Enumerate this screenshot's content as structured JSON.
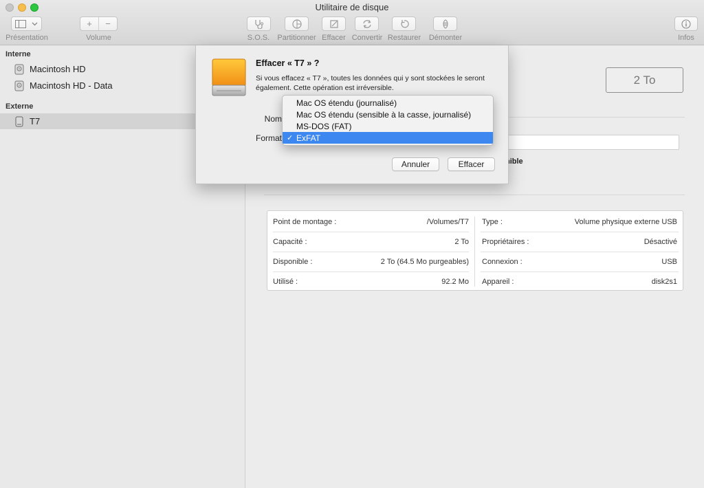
{
  "window": {
    "title": "Utilitaire de disque"
  },
  "toolbar": {
    "presentation_label": "Présentation",
    "volume_label": "Volume",
    "volume_add": "+",
    "volume_remove": "−",
    "sos_label": "S.O.S.",
    "partition_label": "Partitionner",
    "erase_label": "Effacer",
    "convert_label": "Convertir",
    "restore_label": "Restaurer",
    "unmount_label": "Démonter",
    "info_label": "Infos"
  },
  "sidebar": {
    "internal_header": "Interne",
    "external_header": "Externe",
    "internal_items": [
      {
        "label": "Macintosh HD"
      },
      {
        "label": "Macintosh HD - Data"
      }
    ],
    "external_items": [
      {
        "label": "T7"
      }
    ]
  },
  "main": {
    "capacity_box": "2 To",
    "behind_text": "nible",
    "info": {
      "left": [
        {
          "key": "Point de montage :",
          "value": "/Volumes/T7"
        },
        {
          "key": "Capacité :",
          "value": "2 To"
        },
        {
          "key": "Disponible :",
          "value": "2 To (64.5 Mo purgeables)"
        },
        {
          "key": "Utilisé :",
          "value": "92.2 Mo"
        }
      ],
      "right": [
        {
          "key": "Type :",
          "value": "Volume physique externe USB"
        },
        {
          "key": "Propriétaires :",
          "value": "Désactivé"
        },
        {
          "key": "Connexion :",
          "value": "USB"
        },
        {
          "key": "Appareil :",
          "value": "disk2s1"
        }
      ]
    }
  },
  "dialog": {
    "title": "Effacer « T7 » ?",
    "message": "Si vous effacez « T7 », toutes les données qui y sont stockées le seront également. Cette opération est irréversible.",
    "name_label": "Nom",
    "format_label": "Format",
    "cancel_label": "Annuler",
    "erase_label": "Effacer"
  },
  "format_menu": {
    "options": [
      {
        "label": "Mac OS étendu (journalisé)"
      },
      {
        "label": "Mac OS étendu (sensible à la casse, journalisé)"
      },
      {
        "label": "MS-DOS (FAT)"
      },
      {
        "label": "ExFAT"
      }
    ],
    "selected_index": 3,
    "check_mark": "✓"
  },
  "colors": {
    "selection_blue": "#3d87f0",
    "drive_orange": "#f5a623"
  }
}
